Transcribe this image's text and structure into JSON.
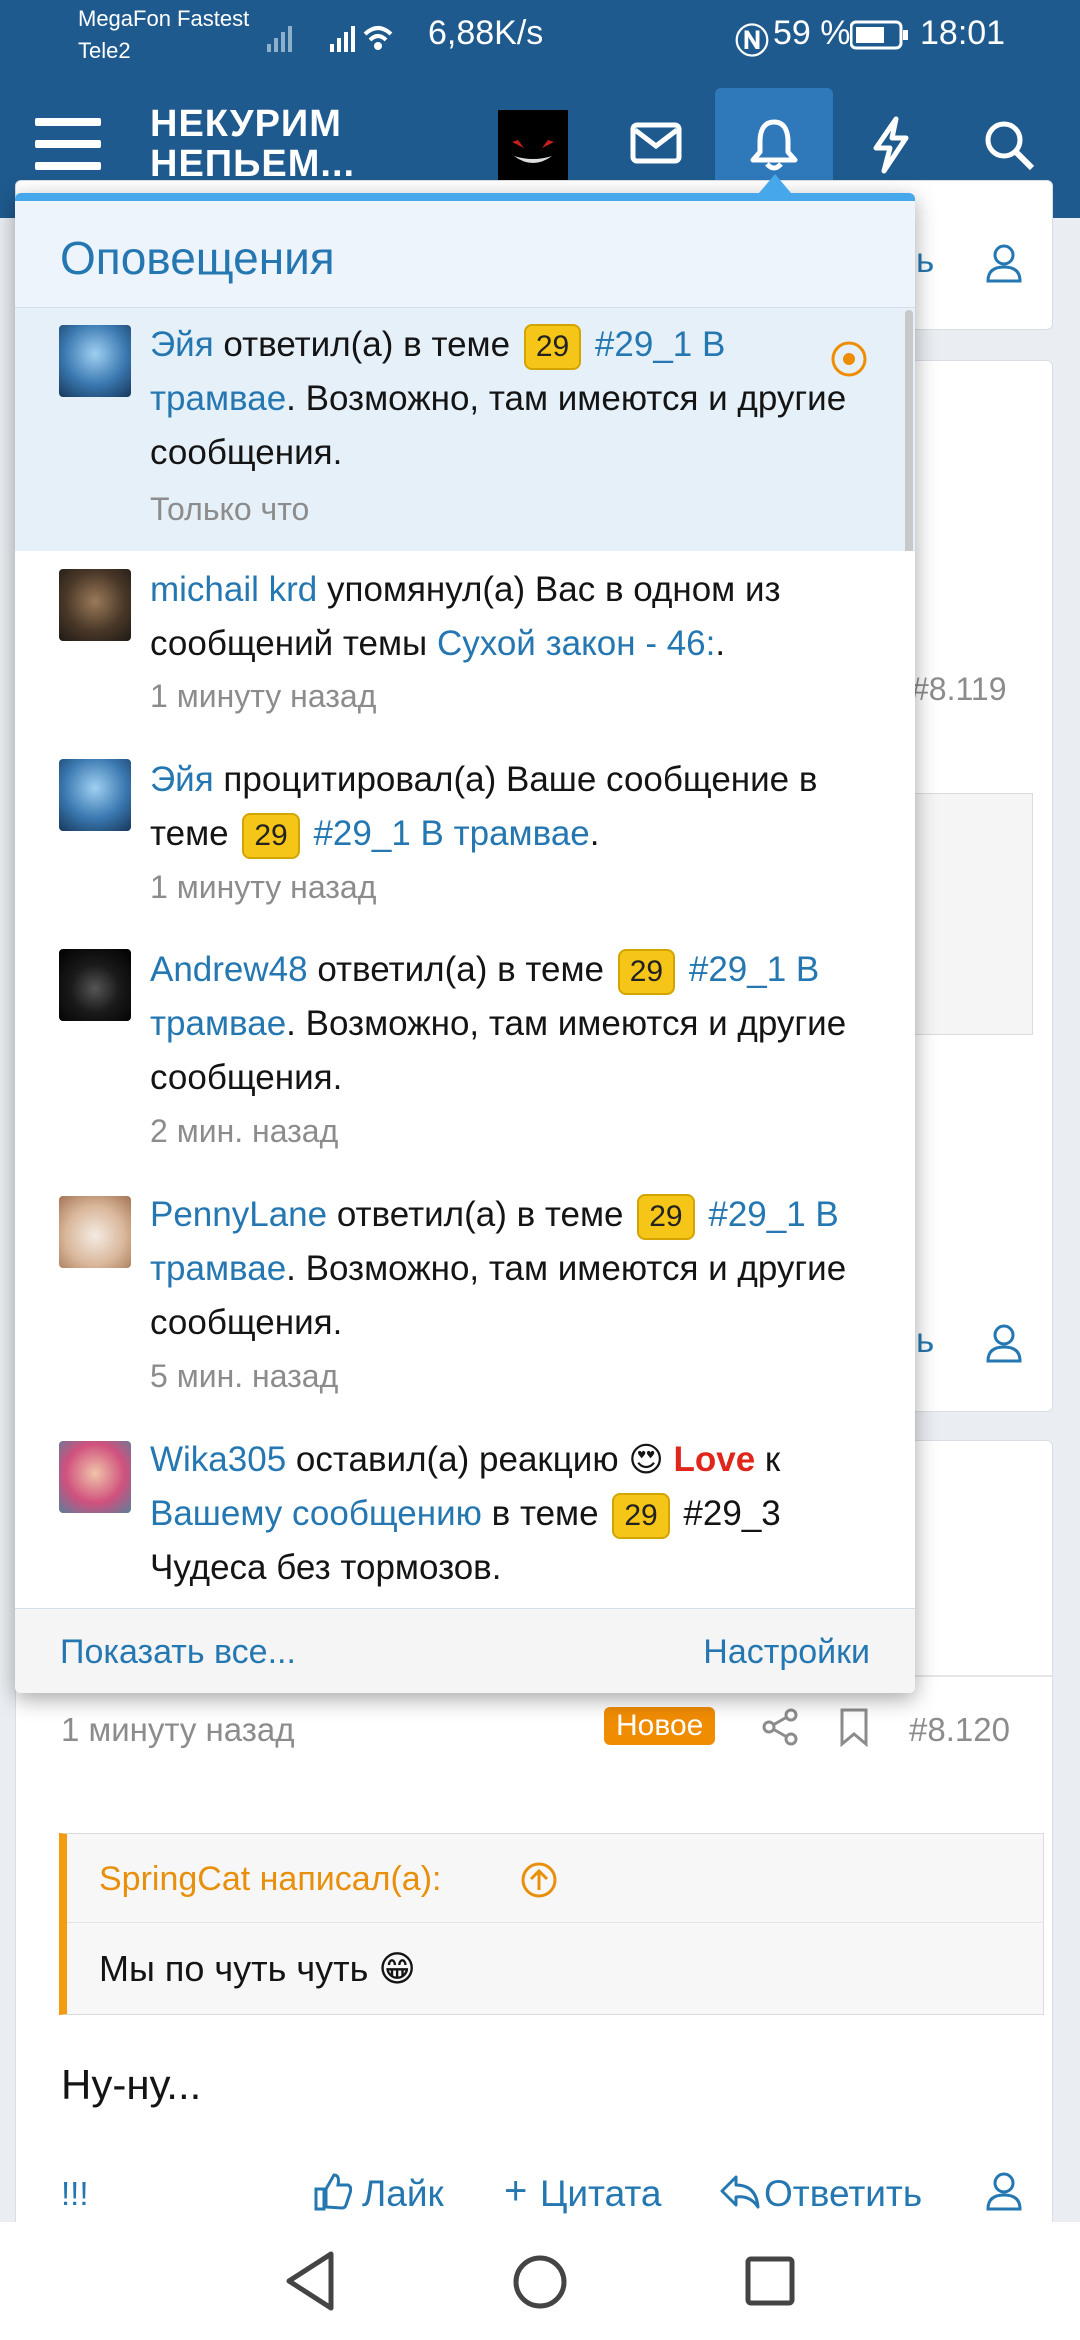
{
  "status_bar": {
    "carrier1": "MegaFon Fastest",
    "carrier2": "Tele2",
    "speed": "6,88K/s",
    "battery": "59 %",
    "time": "18:01"
  },
  "header": {
    "logo_line1": "НЕКУРИМ",
    "logo_line2": "НЕПЬЕМ..."
  },
  "popup": {
    "title": "Оповещения",
    "items": [
      {
        "user": "Эйя",
        "action": " ответил(а) в теме ",
        "tag": "29",
        "thread": "#29_1 В трамвае",
        "rest": ". Возможно, там имеются и другие сообщения.",
        "time": "Только что"
      },
      {
        "user": "michail krd",
        "action": " упомянул(а) Вас в одном из сообщений темы ",
        "thread": "Сухой закон - 46:",
        "rest": ".",
        "time": "1 минуту назад"
      },
      {
        "user": "Эйя",
        "action": " процитировал(а) Ваше сообщение в теме ",
        "tag": "29",
        "thread": "#29_1 В трамвае",
        "rest": ".",
        "time": "1 минуту назад"
      },
      {
        "user": "Andrew48",
        "action": " ответил(а) в теме ",
        "tag": "29",
        "thread": "#29_1 В трамвае",
        "rest": ". Возможно, там имеются и другие сообщения.",
        "time": "2 мин. назад"
      },
      {
        "user": "PennyLane",
        "action": " ответил(а) в теме ",
        "tag": "29",
        "thread": "#29_1 В трамвае",
        "rest": ". Возможно, там имеются и другие сообщения.",
        "time": "5 мин. назад"
      },
      {
        "user": "Wika305",
        "action": " оставил(а) реакцию ",
        "reaction": "Love",
        "action2": " к ",
        "target": "Вашему сообщению",
        "action3": " в теме ",
        "tag": "29",
        "thread": "#29_3 Чудеса без тормозов."
      }
    ],
    "show_all": "Показать все...",
    "settings": "Настройки"
  },
  "background": {
    "post1_number": "#8.119",
    "post2_time": "1 минуту назад",
    "post2_new_badge": "Новое",
    "post2_number": "#8.120",
    "quote_author": "SpringCat написал(а):",
    "quote_text": "Мы по чуть чуть 😁",
    "post2_text": "Ну-ну...",
    "actions": {
      "exclaim": "!!!",
      "like": "Лайк",
      "quote": "Цитата",
      "reply": "Ответить"
    },
    "partial_reply_suffix": "ь"
  },
  "colors": {
    "header": "#1f5a8e",
    "link": "#2577b1",
    "tag": "#f5c518",
    "quote_accent": "#f39c12",
    "new_badge": "#f08c00"
  }
}
